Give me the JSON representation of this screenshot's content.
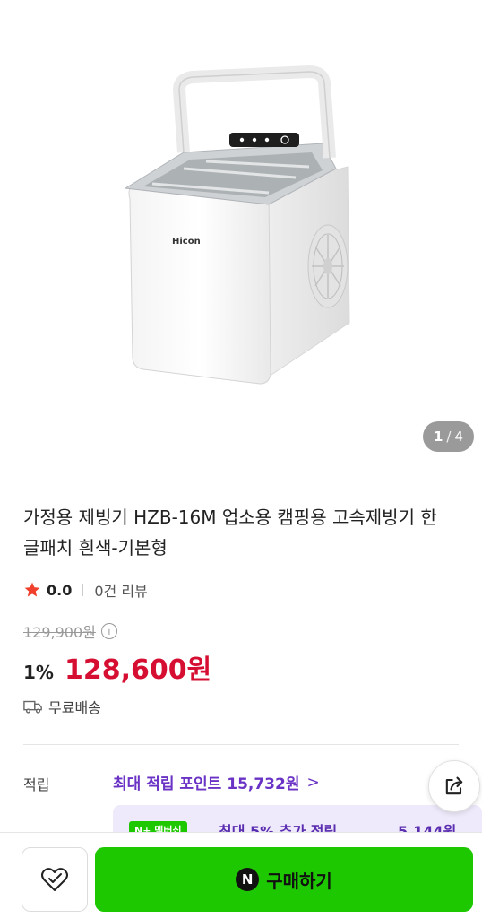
{
  "gallery": {
    "current": "1",
    "separator": "/",
    "total": "4",
    "product_brand_text": "Hicon"
  },
  "product": {
    "title": "가정용 제빙기 HZB-16M 업소용 캠핑용 고속제빙기 한글패치 흰색-기본형",
    "rating": "0.0",
    "review_count": "0건 리뷰",
    "original_price": "129,900원",
    "discount": "1%",
    "price": "128,600원",
    "shipping": "무료배송"
  },
  "points": {
    "label": "적립",
    "link_text": "최대 적립 포인트 15,732원",
    "chevron": ">",
    "promo_badge": "N+ 멤버십",
    "promo_text": "최대 5% 추가 적립",
    "promo_amount": "5,144원"
  },
  "actions": {
    "buy_label": "구매하기",
    "naver_logo": "N"
  },
  "icons": {
    "star": "star-icon",
    "info": "info-icon",
    "truck": "truck-icon",
    "share": "share-icon",
    "heart": "heart-icon"
  },
  "colors": {
    "price_red": "#d60f32",
    "buy_green": "#1ec800",
    "points_purple": "#6a33c5",
    "star_red": "#f0402b"
  }
}
